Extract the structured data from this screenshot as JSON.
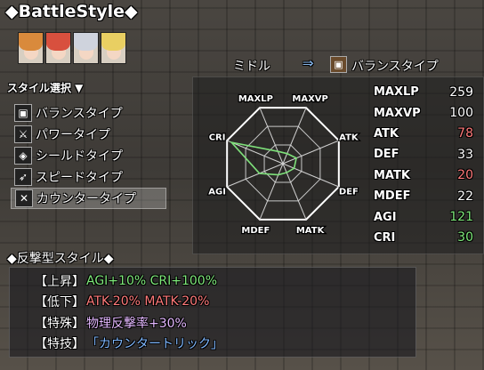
{
  "title": "◆BattleStyle◆",
  "portraits": [
    {
      "name": "orange-hair-girl-portrait",
      "hair": "#d98a3c"
    },
    {
      "name": "red-hair-girl-portrait",
      "hair": "#d8503e"
    },
    {
      "name": "white-hair-girl-portrait",
      "hair": "#cfd3dd"
    },
    {
      "name": "blonde-hair-girl-portrait",
      "hair": "#e9cf62"
    }
  ],
  "style_select_label": "スタイル選択 ▼",
  "header": {
    "character": "ミドル",
    "arrow": "⇒",
    "current_style": "バランスタイプ"
  },
  "style_list": [
    {
      "label": "バランスタイプ",
      "icon": "balance-icon",
      "glyph": "▣",
      "selected": false
    },
    {
      "label": "パワータイプ",
      "icon": "power-sword-icon",
      "glyph": "⚔",
      "selected": false
    },
    {
      "label": "シールドタイプ",
      "icon": "shield-icon",
      "glyph": "◈",
      "selected": false
    },
    {
      "label": "スピードタイプ",
      "icon": "speed-icon",
      "glyph": "➶",
      "selected": false
    },
    {
      "label": "カウンタータイプ",
      "icon": "counter-icon",
      "glyph": "✕",
      "selected": true
    }
  ],
  "radar": {
    "axes": [
      "MAXLP",
      "MAXVP",
      "ATK",
      "DEF",
      "MATK",
      "MDEF",
      "AGI",
      "CRI"
    ],
    "levels": 3,
    "values": [
      0.22,
      0.18,
      0.24,
      0.2,
      0.16,
      0.2,
      0.42,
      0.92
    ],
    "line_color": "#7ee07a"
  },
  "stats": [
    {
      "label": "MAXLP",
      "value": "259",
      "color": "#ffffff"
    },
    {
      "label": "MAXVP",
      "value": "100",
      "color": "#ffffff"
    },
    {
      "label": "ATK",
      "value": "78",
      "color": "#ff7a7a"
    },
    {
      "label": "DEF",
      "value": "33",
      "color": "#ffffff"
    },
    {
      "label": "MATK",
      "value": "20",
      "color": "#ff7a7a"
    },
    {
      "label": "MDEF",
      "value": "22",
      "color": "#ffffff"
    },
    {
      "label": "AGI",
      "value": "121",
      "color": "#7ee87a"
    },
    {
      "label": "CRI",
      "value": "30",
      "color": "#7ee87a"
    }
  ],
  "description": {
    "title": "◆反撃型スタイル◆",
    "rows": [
      {
        "key": "【上昇】",
        "text": "AGI+10% CRI+100%",
        "color": "#7ee87a"
      },
      {
        "key": "【低下】",
        "text": "ATK-20% MATK-20%",
        "color": "#ff7a7a"
      },
      {
        "key": "【特殊】",
        "text": "物理反撃率+30%",
        "color": "#e4b8ff"
      },
      {
        "key": "【特技】",
        "text": "「カウンタートリック」",
        "color": "#7fb8ff"
      }
    ]
  }
}
